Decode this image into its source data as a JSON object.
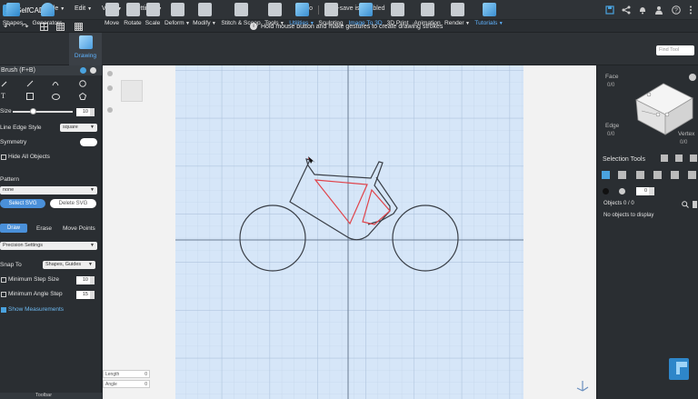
{
  "app": {
    "name": "SelfCAD"
  },
  "menu": {
    "file": "File",
    "edit": "Edit",
    "view": "View",
    "settings": "Settings"
  },
  "title": {
    "project": "Intro",
    "autosave": "Auto-save is disabled"
  },
  "hint": {
    "text": "Hold mouse button and make gestures to create drawing strokes"
  },
  "toolbar": {
    "shapes": "Shapes",
    "generators": "Generators",
    "drawing": "Drawing",
    "move": "Move",
    "rotate": "Rotate",
    "scale": "Scale",
    "deform": "Deform",
    "modify": "Modify",
    "stitch": "Stitch & Scoop",
    "tools": "Tools",
    "utilities": "Utilities",
    "sculpting": "Sculpting",
    "image_to_3d": "Image To 3D",
    "print": "3D Print",
    "animation": "Animation",
    "render": "Render",
    "tutorials": "Tutorials"
  },
  "search": {
    "placeholder": "Find Tool"
  },
  "left_panel": {
    "title": "Brush (F+B)",
    "size_label": "Size",
    "size_value": "10",
    "line_edge_label": "Line Edge Style",
    "line_edge_value": "square",
    "symmetry_label": "Symmetry",
    "hide_all_label": "Hide All Objects",
    "pattern_label": "Pattern",
    "pattern_value": "none",
    "select_svg": "Select SVG",
    "delete_svg": "Delete SVG",
    "draw": "Draw",
    "erase": "Erase",
    "move_points": "Move Points",
    "precision": "Precision Settings",
    "snap_label": "Snap To",
    "snap_value": "Shapes, Guides",
    "min_step_label": "Minimum Step Size",
    "min_step_value": "10",
    "min_angle_label": "Minimum Angle Step",
    "min_angle_value": "15",
    "show_measurements": "Show Measurements",
    "length_label": "Length",
    "length_value": "0",
    "angle_label": "Angle",
    "angle_value": "0",
    "footer": "Toolbar"
  },
  "view_cube": {
    "face": "Face",
    "face_count": "0/0",
    "edge": "Edge",
    "edge_count": "0/0",
    "vertex": "Vertex",
    "vertex_count": "0/0"
  },
  "selection": {
    "title": "Selection Tools",
    "value": "0",
    "objects": "Objects 0 / 0",
    "empty": "No objects to display"
  },
  "colors": {
    "accent": "#4aa3df",
    "viewport": "#d6e6f8",
    "stroke_dark": "#3a3f47",
    "stroke_red": "#e0434a"
  }
}
